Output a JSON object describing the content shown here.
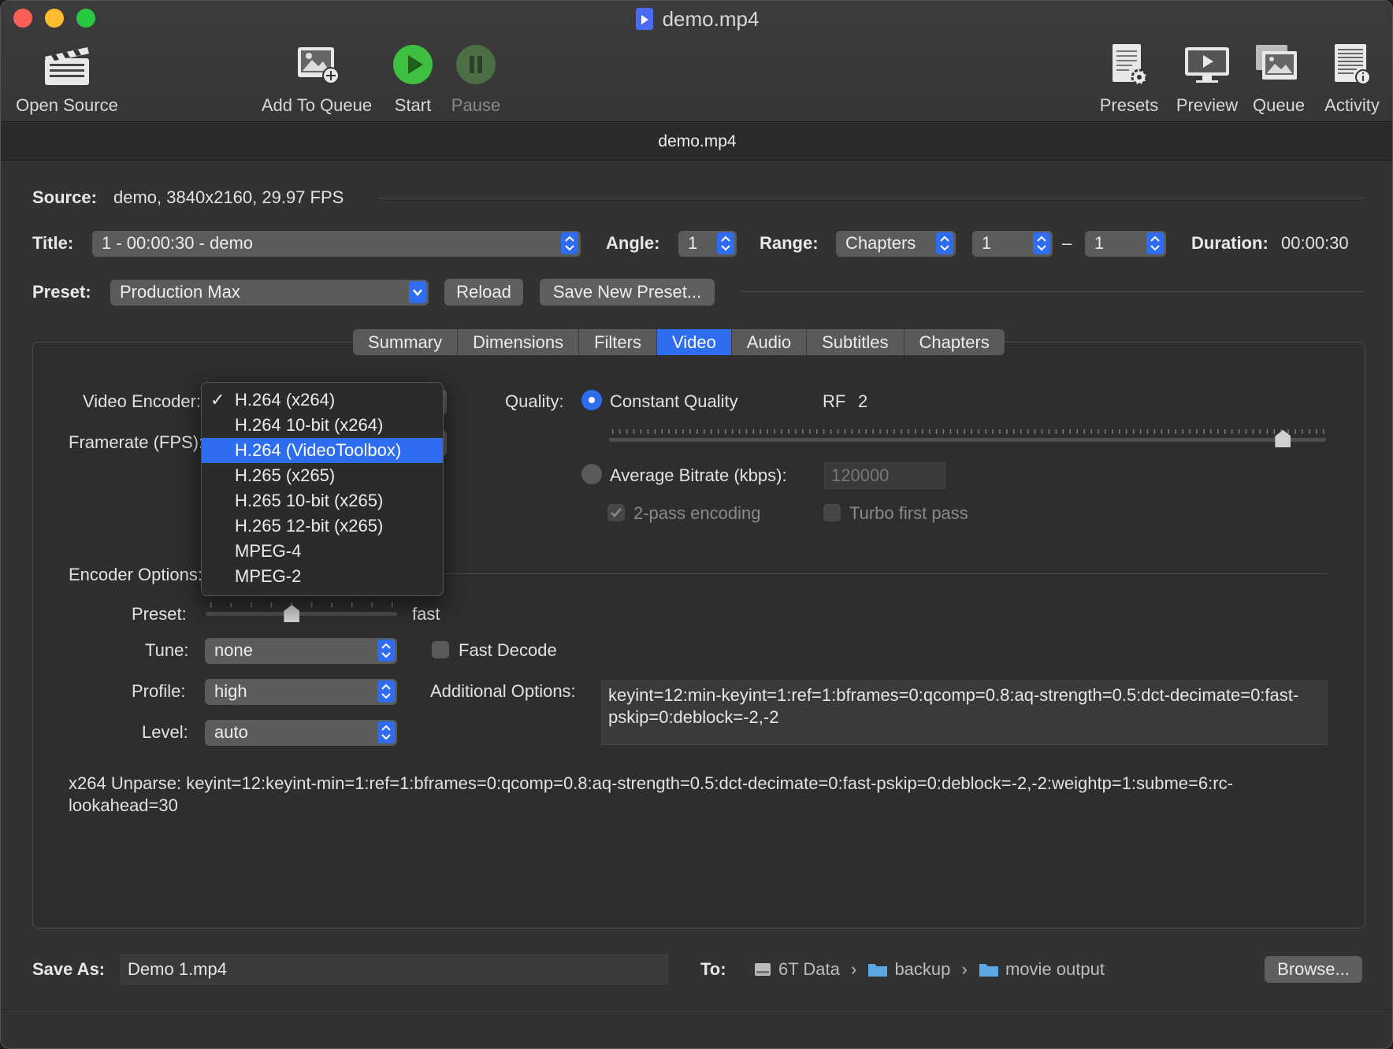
{
  "window": {
    "title": "demo.mp4",
    "subtitle": "demo.mp4"
  },
  "toolbar": {
    "open_source": "Open Source",
    "add_to_queue": "Add To Queue",
    "start": "Start",
    "pause": "Pause",
    "presets": "Presets",
    "preview": "Preview",
    "queue": "Queue",
    "activity": "Activity"
  },
  "source": {
    "label": "Source:",
    "value": "demo, 3840x2160, 29.97 FPS"
  },
  "title_row": {
    "label": "Title:",
    "value": "1 - 00:00:30 - demo",
    "angle_label": "Angle:",
    "angle": "1",
    "range_label": "Range:",
    "range_type": "Chapters",
    "range_start": "1",
    "range_sep": "–",
    "range_end": "1",
    "duration_label": "Duration:",
    "duration": "00:00:30"
  },
  "preset_row": {
    "label": "Preset:",
    "value": "Production Max",
    "reload": "Reload",
    "save_new": "Save New Preset..."
  },
  "tabs": [
    "Summary",
    "Dimensions",
    "Filters",
    "Video",
    "Audio",
    "Subtitles",
    "Chapters"
  ],
  "active_tab": "Video",
  "video": {
    "encoder_label": "Video Encoder:",
    "framerate_label": "Framerate (FPS):",
    "encoder_options_label": "Encoder Options:",
    "quality_label": "Quality:",
    "constant_quality": "Constant Quality",
    "rf_label": "RF",
    "rf_value": "2",
    "rf_level": 0.94,
    "avg_bitrate_label": "Average Bitrate (kbps):",
    "avg_bitrate_value": "120000",
    "two_pass": "2-pass encoding",
    "turbo": "Turbo first pass",
    "preset_label": "Preset:",
    "preset_value": "fast",
    "preset_level": 0.45,
    "tune_label": "Tune:",
    "tune_value": "none",
    "fast_decode": "Fast Decode",
    "profile_label": "Profile:",
    "profile_value": "high",
    "level_label": "Level:",
    "level_value": "auto",
    "additional_label": "Additional Options:",
    "additional_value": "keyint=12:min-keyint=1:ref=1:bframes=0:qcomp=0.8:aq-strength=0.5:dct-decimate=0:fast-pskip=0:deblock=-2,-2",
    "unparse": "x264 Unparse: keyint=12:keyint-min=1:ref=1:bframes=0:qcomp=0.8:aq-strength=0.5:dct-decimate=0:fast-pskip=0:deblock=-2,-2:weightp=1:subme=6:rc-lookahead=30"
  },
  "encoder_menu": {
    "items": [
      "H.264 (x264)",
      "H.264 10-bit (x264)",
      "H.264 (VideoToolbox)",
      "H.265 (x265)",
      "H.265 10-bit (x265)",
      "H.265 12-bit (x265)",
      "MPEG-4",
      "MPEG-2"
    ],
    "checked": "H.264 (x264)",
    "highlighted": "H.264 (VideoToolbox)"
  },
  "save": {
    "label": "Save As:",
    "value": "Demo 1.mp4",
    "to_label": "To:",
    "path": [
      "6T Data",
      "backup",
      "movie output"
    ],
    "browse": "Browse..."
  },
  "colors": {
    "accent": "#2f6df0",
    "window_bg": "#323232",
    "start_green": "#3fbf3f"
  }
}
